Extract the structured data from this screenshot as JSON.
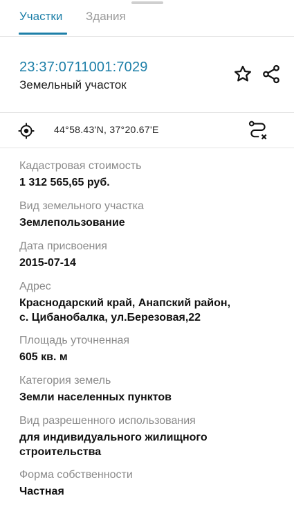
{
  "tabs": [
    {
      "label": "Участки"
    },
    {
      "label": "Здания"
    }
  ],
  "parcel": {
    "cadastral_number": "23:37:0711001:7029",
    "type": "Земельный участок"
  },
  "coordinates": "44°58.43'N, 37°20.67'E",
  "fields": [
    {
      "label": "Кадастровая стоимость",
      "value": "1 312 565,65 руб."
    },
    {
      "label": "Вид земельного участка",
      "value": "Землепользование"
    },
    {
      "label": "Дата присвоения",
      "value": "2015-07-14"
    },
    {
      "label": "Адрес",
      "value": "Краснодарский край, Анапский район,\nс. Цибанобалка, ул.Березовая,22"
    },
    {
      "label": "Площадь уточненная",
      "value": "605 кв. м"
    },
    {
      "label": "Категория земель",
      "value": "Земли населенных пунктов"
    },
    {
      "label": "Вид разрешенного использования",
      "value": "для индивидуального жилищного\nстроительства"
    },
    {
      "label": "Форма собственности",
      "value": "Частная"
    }
  ],
  "colors": {
    "accent": "#1d7fa8"
  },
  "icons": [
    "star-icon",
    "share-icon",
    "locate-icon",
    "route-icon"
  ]
}
